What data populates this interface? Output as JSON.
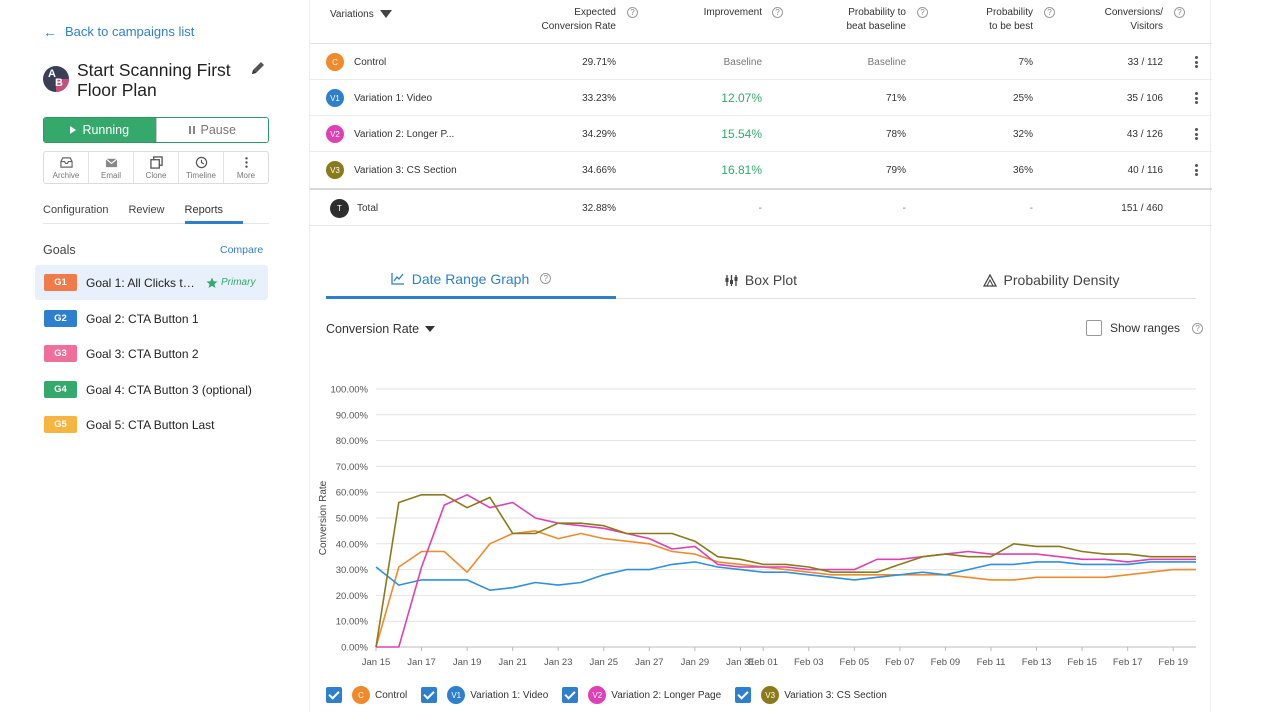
{
  "sidebar": {
    "back_label": "Back to campaigns list",
    "campaign_title": "Start Scanning First Floor Plan",
    "avatar": {
      "a": "A",
      "b": "B"
    },
    "run_label": "Running",
    "pause_label": "Pause",
    "actions": [
      {
        "label": "Archive",
        "icon": "archive-icon"
      },
      {
        "label": "Email",
        "icon": "email-icon"
      },
      {
        "label": "Clone",
        "icon": "clone-icon"
      },
      {
        "label": "Timeline",
        "icon": "timeline-icon"
      },
      {
        "label": "More",
        "icon": "more-icon"
      }
    ],
    "tabs": [
      "Configuration",
      "Review",
      "Reports"
    ],
    "active_tab": "Reports",
    "goals_label": "Goals",
    "compare_label": "Compare",
    "goals": [
      {
        "badge": "G1",
        "name": "Goal 1: All Clicks to ...",
        "color": "#f07a4a",
        "primary": "Primary"
      },
      {
        "badge": "G2",
        "name": "Goal 2: CTA Button 1",
        "color": "#2f7fcf"
      },
      {
        "badge": "G3",
        "name": "Goal 3: CTA Button 2",
        "color": "#ef6f9a"
      },
      {
        "badge": "G4",
        "name": "Goal 4: CTA Button 3 (optional)",
        "color": "#35a86c"
      },
      {
        "badge": "G5",
        "name": "Goal 5: CTA Button Last",
        "color": "#f6b540"
      }
    ]
  },
  "table": {
    "headers": {
      "variations": "Variations",
      "expected_1": "Expected",
      "expected_2": "Conversion Rate",
      "improvement": "Improvement",
      "prob_beat_1": "Probability to",
      "prob_beat_2": "beat baseline",
      "prob_best_1": "Probability",
      "prob_best_2": "to be best",
      "conv_1": "Conversions/",
      "conv_2": "Visitors"
    },
    "rows": [
      {
        "badge": "C",
        "color": "#f08a2a",
        "name": "Control",
        "rate": "29.71%",
        "improvement": "Baseline",
        "beat": "Baseline",
        "best": "7%",
        "conv": "33 / 112"
      },
      {
        "badge": "V1",
        "color": "#2f7fcf",
        "name": "Variation 1: Video",
        "rate": "33.23%",
        "improvement": "12.07%",
        "beat": "71%",
        "best": "25%",
        "conv": "35 / 106"
      },
      {
        "badge": "V2",
        "color": "#e040b5",
        "name": "Variation 2: Longer P...",
        "rate": "34.29%",
        "improvement": "15.54%",
        "beat": "78%",
        "best": "32%",
        "conv": "43 / 126"
      },
      {
        "badge": "V3",
        "color": "#8a7a1a",
        "name": "Variation 3: CS Section",
        "rate": "34.66%",
        "improvement": "16.81%",
        "beat": "79%",
        "best": "36%",
        "conv": "40 / 116"
      }
    ],
    "total": {
      "badge": "T",
      "name": "Total",
      "rate": "32.88%",
      "improvement": "-",
      "beat": "-",
      "best": "-",
      "conv": "151 / 460"
    }
  },
  "graph_tabs": [
    {
      "label": "Date Range Graph",
      "icon": "line-chart-icon"
    },
    {
      "label": "Box Plot",
      "icon": "box-plot-icon"
    },
    {
      "label": "Probability Density",
      "icon": "density-icon"
    }
  ],
  "metric_label": "Conversion Rate",
  "show_ranges_label": "Show ranges",
  "chart_data": {
    "type": "line",
    "ylabel": "Conversion Rate",
    "ylim": [
      0,
      100
    ],
    "yticks": [
      "0.00%",
      "10.00%",
      "20.00%",
      "30.00%",
      "40.00%",
      "50.00%",
      "60.00%",
      "70.00%",
      "80.00%",
      "90.00%",
      "100.00%"
    ],
    "x_labels": [
      "Jan 15",
      "Jan 17",
      "Jan 19",
      "Jan 21",
      "Jan 23",
      "Jan 25",
      "Jan 27",
      "Jan 29",
      "Jan 31",
      "Feb 01",
      "Feb 03",
      "Feb 05",
      "Feb 07",
      "Feb 09",
      "Feb 11",
      "Feb 13",
      "Feb 15",
      "Feb 17",
      "Feb 19"
    ],
    "x": [
      "Jan 15",
      "Jan 16",
      "Jan 17",
      "Jan 18",
      "Jan 19",
      "Jan 20",
      "Jan 21",
      "Jan 22",
      "Jan 23",
      "Jan 24",
      "Jan 25",
      "Jan 26",
      "Jan 27",
      "Jan 28",
      "Jan 29",
      "Jan 30",
      "Jan 31",
      "Feb 01",
      "Feb 02",
      "Feb 03",
      "Feb 04",
      "Feb 05",
      "Feb 06",
      "Feb 07",
      "Feb 08",
      "Feb 09",
      "Feb 10",
      "Feb 11",
      "Feb 12",
      "Feb 13",
      "Feb 14",
      "Feb 15",
      "Feb 16",
      "Feb 17",
      "Feb 18",
      "Feb 19",
      "Feb 20"
    ],
    "grid": true,
    "series": [
      {
        "name": "Control",
        "color": "#f08a2a",
        "values": [
          0,
          31,
          37,
          37,
          29,
          40,
          44,
          45,
          42,
          44,
          42,
          41,
          40,
          37,
          36,
          33,
          32,
          31,
          30,
          29,
          28,
          28,
          28,
          28,
          28,
          28,
          27,
          26,
          26,
          27,
          27,
          27,
          27,
          28,
          29,
          30,
          30
        ]
      },
      {
        "name": "Variation 1: Video",
        "color": "#2f8fe0",
        "values": [
          31,
          24,
          26,
          26,
          26,
          22,
          23,
          25,
          24,
          25,
          28,
          30,
          30,
          32,
          33,
          31,
          30,
          29,
          29,
          28,
          27,
          26,
          27,
          28,
          29,
          28,
          30,
          32,
          32,
          33,
          33,
          32,
          32,
          32,
          33,
          33,
          33
        ]
      },
      {
        "name": "Variation 2: Longer Page",
        "color": "#e040b5",
        "values": [
          0,
          0,
          31,
          55,
          59,
          54,
          56,
          50,
          48,
          47,
          46,
          44,
          42,
          38,
          39,
          32,
          31,
          31,
          31,
          30,
          30,
          30,
          34,
          34,
          35,
          36,
          37,
          36,
          36,
          36,
          35,
          34,
          34,
          33,
          34,
          34,
          34
        ]
      },
      {
        "name": "Variation 3: CS Section",
        "color": "#8a7a1a",
        "values": [
          0,
          56,
          59,
          59,
          54,
          58,
          44,
          44,
          48,
          48,
          47,
          44,
          44,
          44,
          41,
          35,
          34,
          32,
          32,
          31,
          29,
          29,
          29,
          32,
          35,
          36,
          35,
          35,
          40,
          39,
          39,
          37,
          36,
          36,
          35,
          35,
          35
        ]
      }
    ]
  }
}
